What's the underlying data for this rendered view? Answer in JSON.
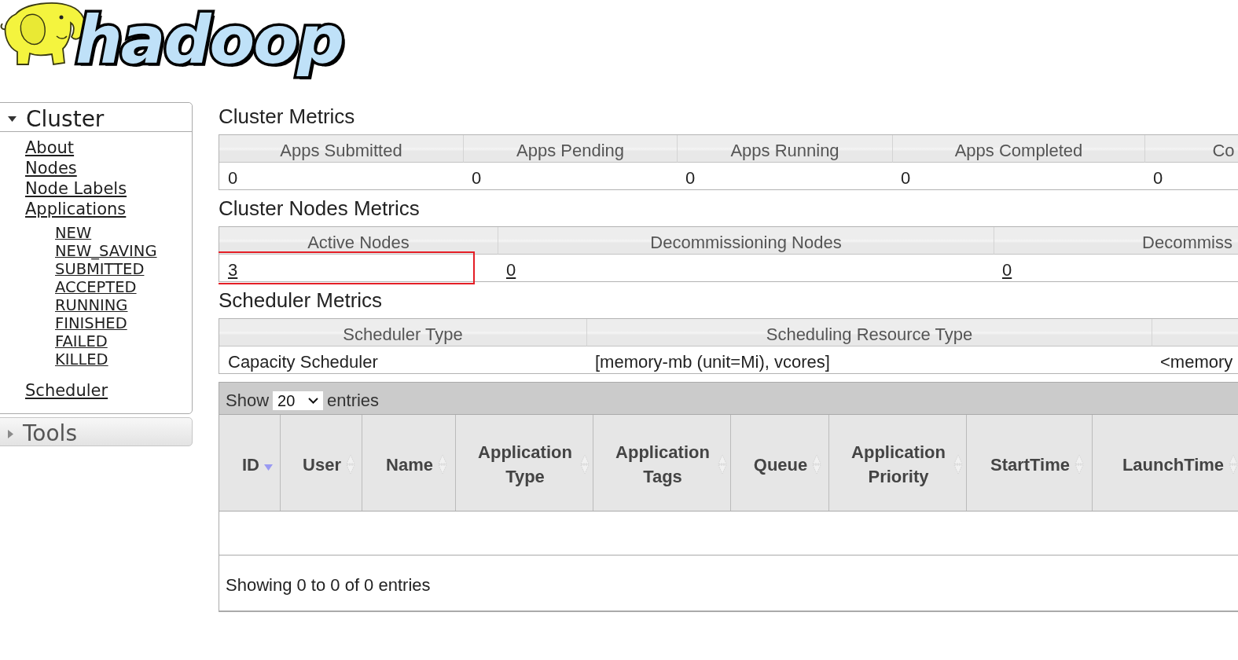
{
  "logo": {
    "wordmark": "hadoop"
  },
  "sidebar": {
    "sections": [
      {
        "title": "Cluster",
        "expanded": true,
        "items": [
          {
            "label": "About"
          },
          {
            "label": "Nodes"
          },
          {
            "label": "Node Labels"
          },
          {
            "label": "Applications",
            "children": [
              {
                "label": "NEW"
              },
              {
                "label": "NEW_SAVING"
              },
              {
                "label": "SUBMITTED"
              },
              {
                "label": "ACCEPTED"
              },
              {
                "label": "RUNNING"
              },
              {
                "label": "FINISHED"
              },
              {
                "label": "FAILED"
              },
              {
                "label": "KILLED"
              }
            ]
          },
          {
            "label": "Scheduler"
          }
        ]
      },
      {
        "title": "Tools",
        "expanded": false
      }
    ]
  },
  "cluster_metrics": {
    "title": "Cluster Metrics",
    "columns": [
      "Apps Submitted",
      "Apps Pending",
      "Apps Running",
      "Apps Completed",
      "Co"
    ],
    "values": [
      {
        "text": "0"
      },
      {
        "text": "0"
      },
      {
        "text": "0"
      },
      {
        "text": "0"
      },
      {
        "text": "0"
      }
    ]
  },
  "cluster_nodes_metrics": {
    "title": "Cluster Nodes Metrics",
    "columns": [
      "Active Nodes",
      "Decommissioning Nodes",
      "Decommiss"
    ],
    "values": [
      {
        "text": "3",
        "link": true,
        "highlighted": true
      },
      {
        "text": "0",
        "link": true,
        "highlighted": false
      },
      {
        "text": "0",
        "link": true,
        "highlighted": false
      }
    ]
  },
  "scheduler_metrics": {
    "title": "Scheduler Metrics",
    "columns": [
      "Scheduler Type",
      "Scheduling Resource Type"
    ],
    "values": [
      {
        "text": "Capacity Scheduler"
      },
      {
        "text": "[memory-mb (unit=Mi), vcores]"
      },
      {
        "text": "<memory"
      }
    ]
  },
  "applications_table": {
    "length_menu": {
      "before": "Show",
      "value": "20",
      "after": "entries"
    },
    "columns": [
      {
        "label": "ID",
        "sorted": true
      },
      {
        "label": "User",
        "sorted": false
      },
      {
        "label": "Name",
        "sorted": false
      },
      {
        "label": "Application Type",
        "sorted": false
      },
      {
        "label": "Application Tags",
        "sorted": false
      },
      {
        "label": "Queue",
        "sorted": false
      },
      {
        "label": "Application Priority",
        "sorted": false
      },
      {
        "label": "StartTime",
        "sorted": false
      },
      {
        "label": "LaunchTime",
        "sorted": false
      }
    ],
    "info": "Showing 0 to 0 of 0 entries"
  }
}
